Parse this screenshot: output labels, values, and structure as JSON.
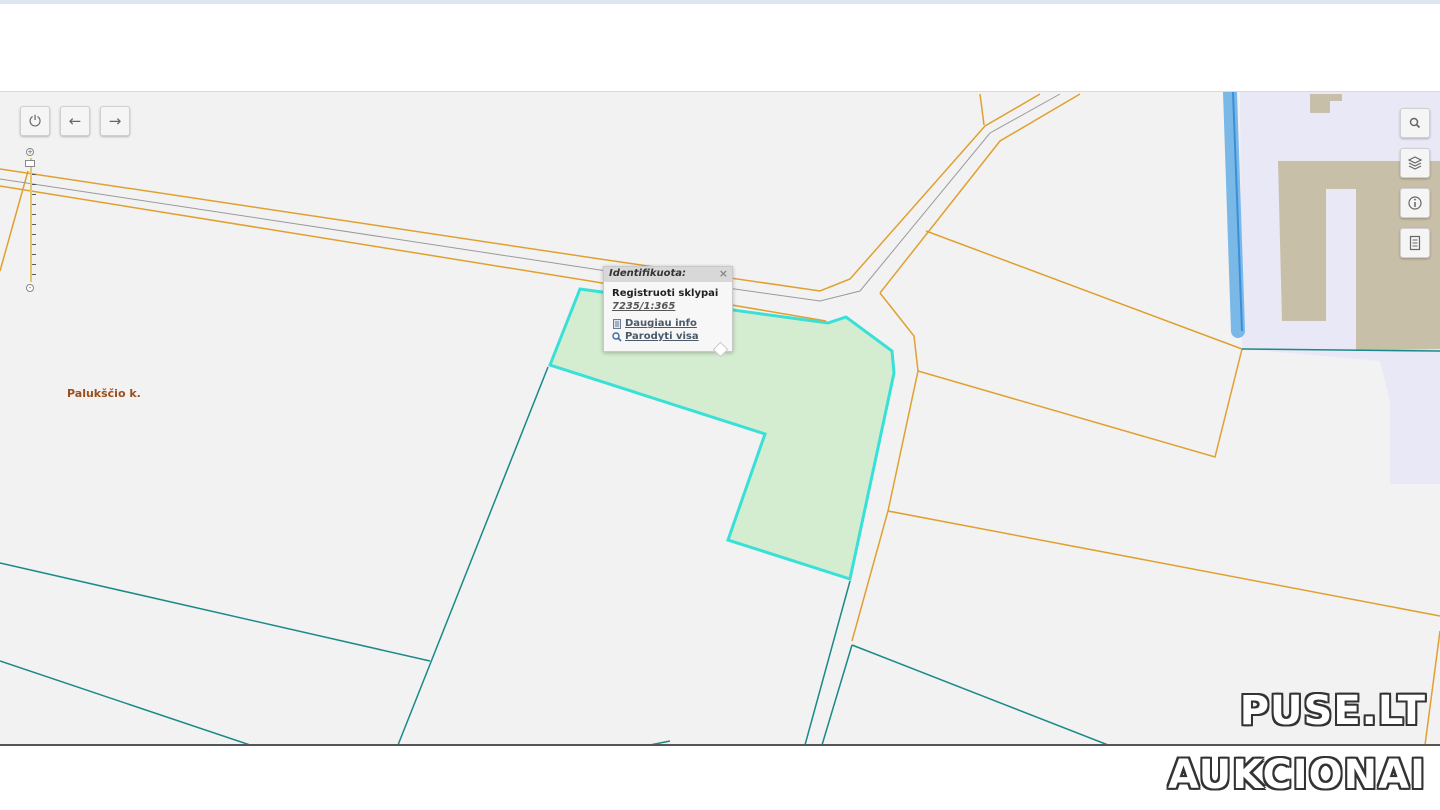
{
  "map": {
    "place_label": "Palukščio k.",
    "colors": {
      "background": "#f2f2f2",
      "road_boundary": "#e0a030",
      "parcel_boundary": "#1a8a86",
      "selected_fill": "#d4ecd0",
      "selected_outline": "#38e0d8",
      "water": "#7ab8e8",
      "building": "#c8bfa8",
      "industrial_area": "#e8e8f8"
    }
  },
  "controls": {
    "left": {
      "home_icon": "power-icon",
      "back_icon": "arrow-left-icon",
      "forward_icon": "arrow-right-icon"
    },
    "right": {
      "search_icon": "search-icon",
      "layers_icon": "layers-icon",
      "info_icon": "info-icon",
      "legend_icon": "legend-icon"
    }
  },
  "popup": {
    "header": "Identifikuota:",
    "close": "×",
    "title": "Registruoti sklypai",
    "id": "7235/1:365",
    "link_more": "Daugiau info",
    "link_show_all": "Parodyti visa"
  },
  "watermark": {
    "line1": "PUSE.LT",
    "line2": "AUKCIONAI"
  }
}
